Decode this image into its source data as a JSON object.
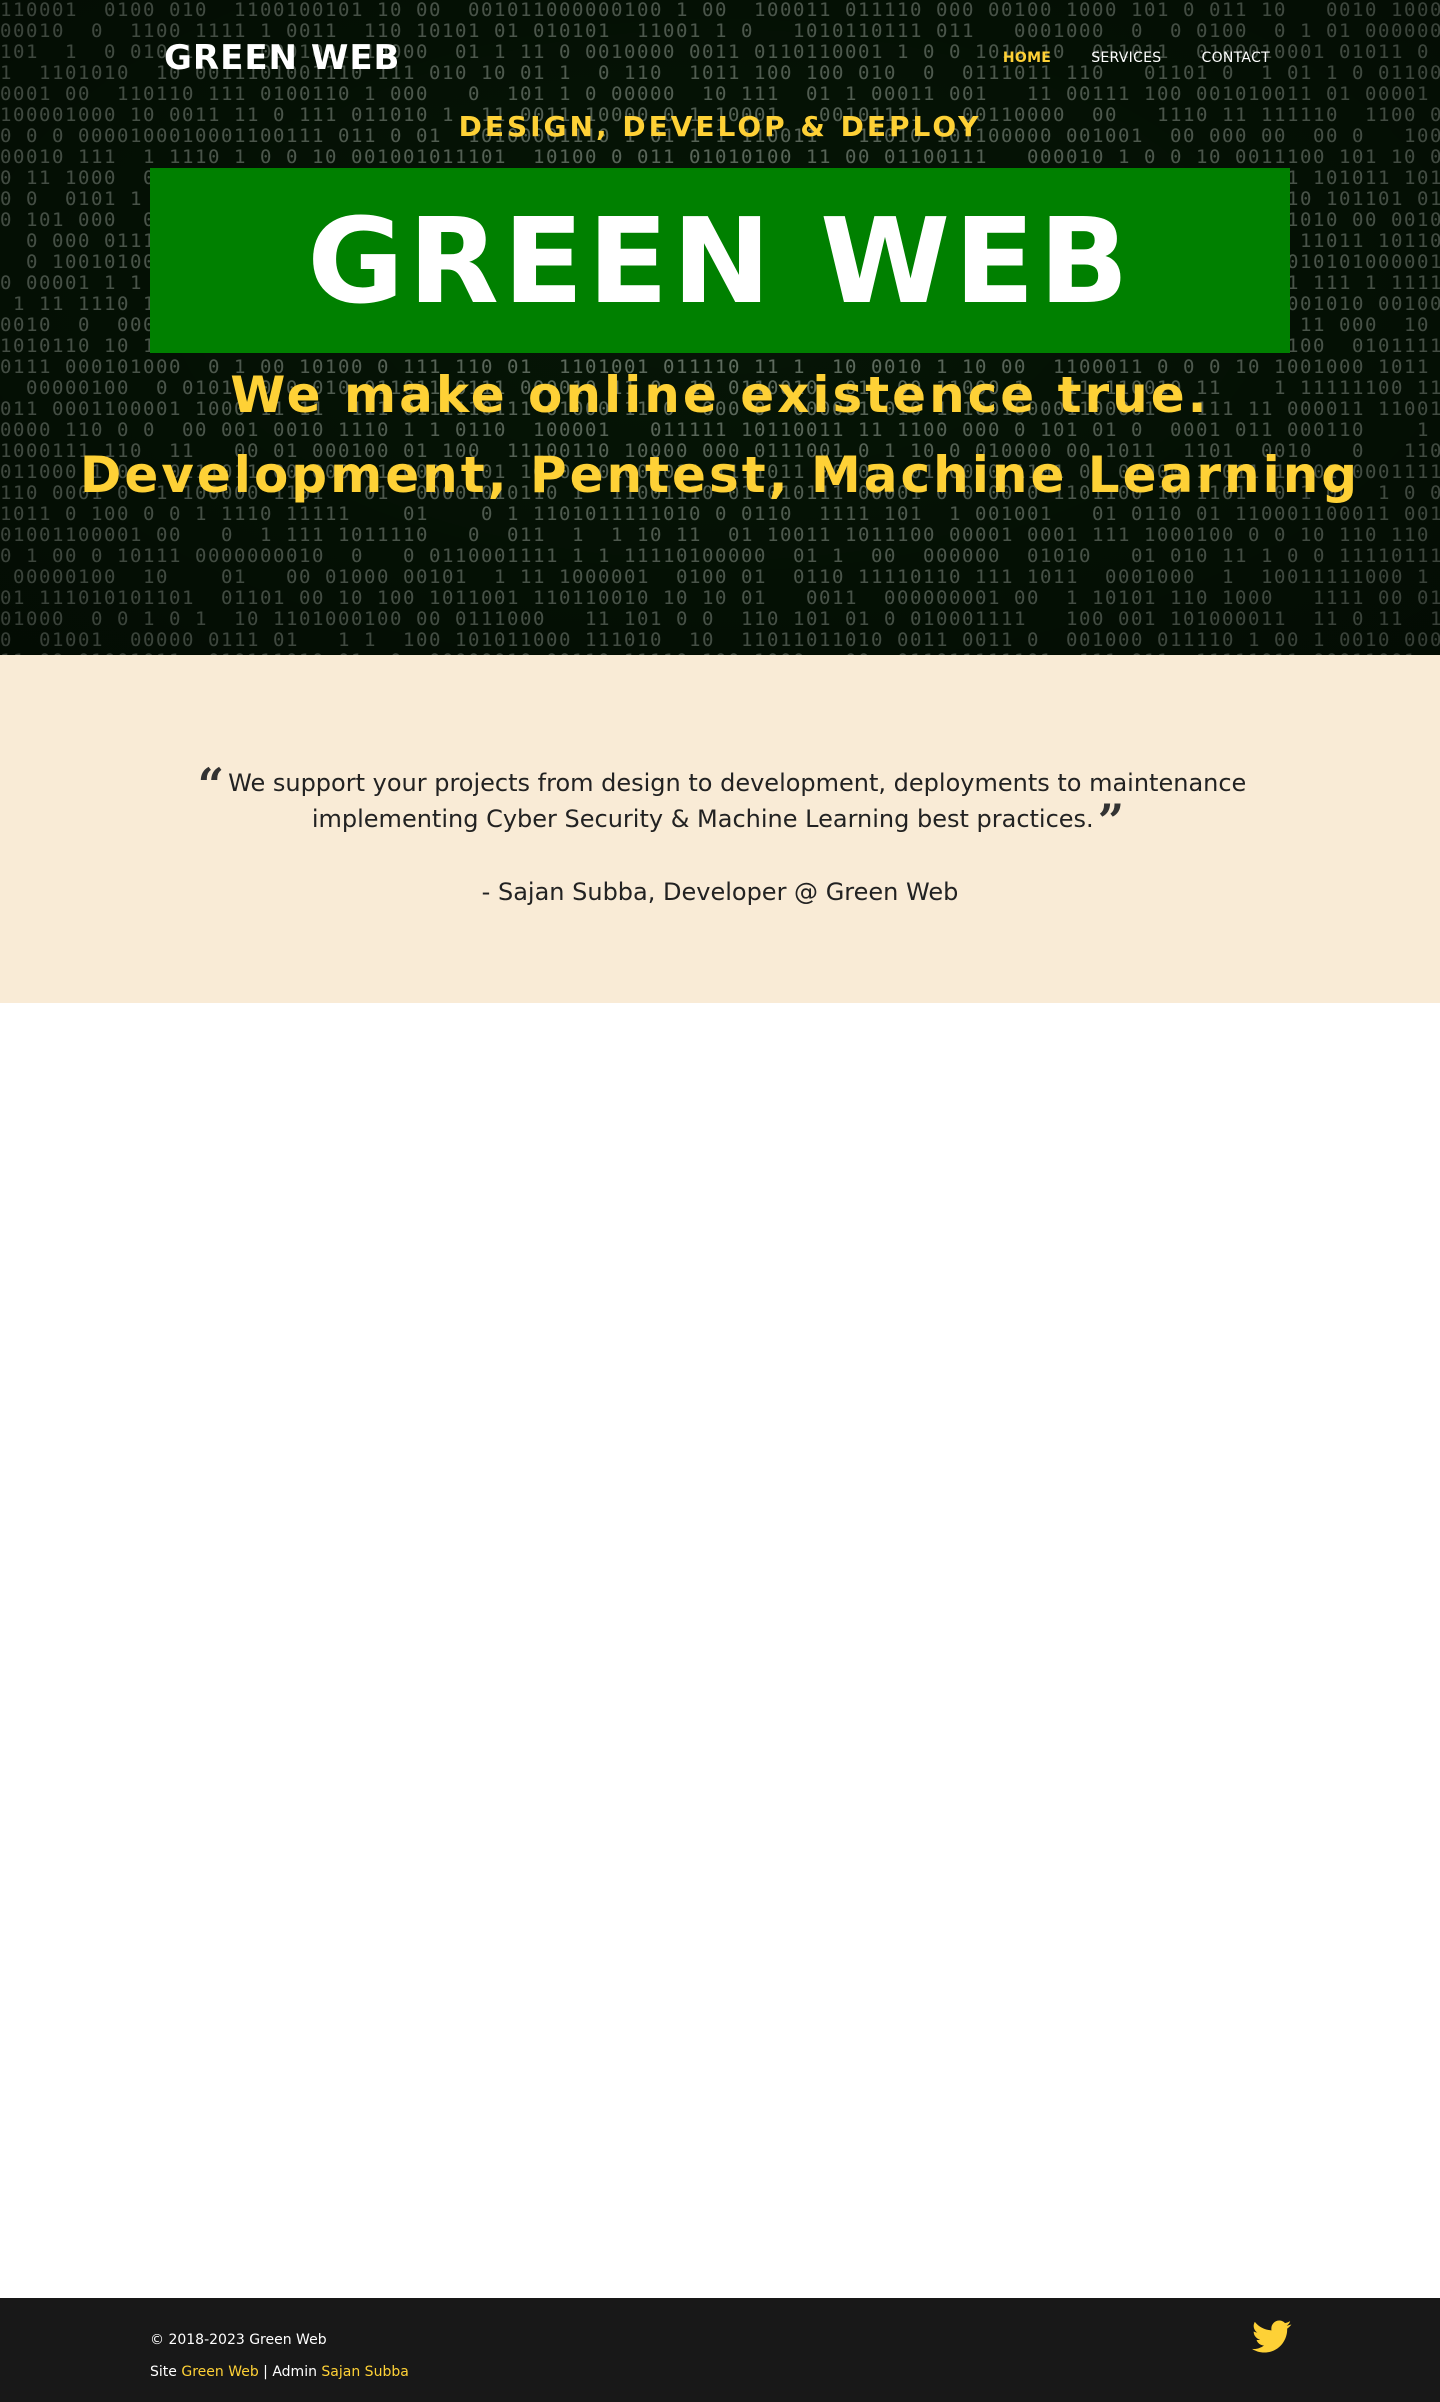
{
  "navbar": {
    "brand": "GREEN WEB",
    "items": [
      {
        "label": "HOME",
        "active": true
      },
      {
        "label": "SERVICES",
        "active": false
      },
      {
        "label": "CONTACT",
        "active": false
      }
    ]
  },
  "hero": {
    "tagline": "DESIGN, DEVELOP & DEPLOY",
    "title": "GREEN WEB",
    "line1": "We make online existence true.",
    "line2": "Development, Pentest, Machine Learning"
  },
  "quote": {
    "text": "We support your projects from design to development, deployments to maintenance implementing Cyber Security & Machine Learning best practices.",
    "open_icon": "quote-left-icon",
    "close_icon": "quote-right-icon",
    "author": "- Sajan Subba, Developer @ Green Web"
  },
  "footer": {
    "copyright": "© 2018-2023 Green Web",
    "site_prefix": "Site",
    "site_link": "Green Web",
    "separator": "| Admin",
    "admin_link": "Sajan Subba",
    "social_icon": "twitter-icon"
  },
  "colors": {
    "accent": "#fed136",
    "brand_green": "#008000",
    "quote_bg": "#f9ebd6",
    "footer_bg": "#181818"
  }
}
